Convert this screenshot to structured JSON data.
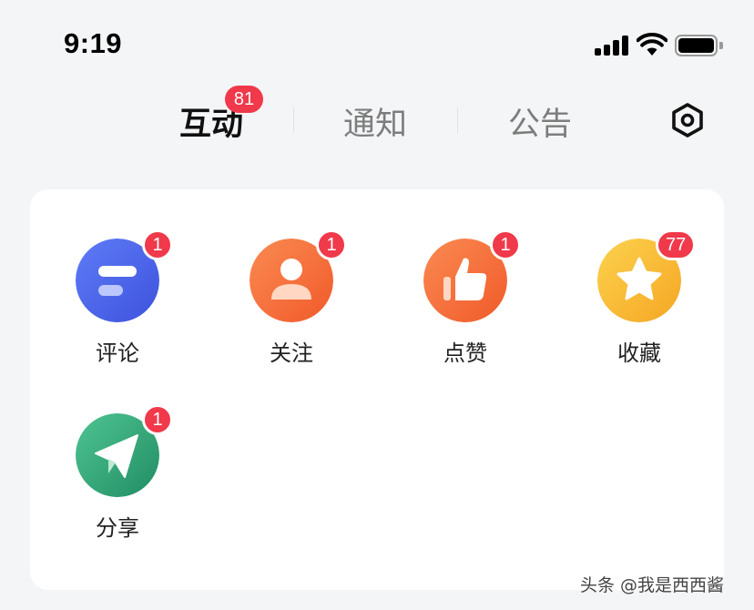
{
  "status_bar": {
    "time": "9:19",
    "icons": [
      "signal-icon",
      "wifi-icon",
      "battery-icon"
    ]
  },
  "tabs": [
    {
      "label": "互动",
      "badge": "81",
      "active": true
    },
    {
      "label": "通知",
      "active": false
    },
    {
      "label": "公告",
      "active": false
    }
  ],
  "header": {
    "settings_icon": "settings-icon"
  },
  "items": [
    {
      "label": "评论",
      "badge": "1",
      "icon": "comment-icon"
    },
    {
      "label": "关注",
      "badge": "1",
      "icon": "follow-icon"
    },
    {
      "label": "点赞",
      "badge": "1",
      "icon": "like-icon"
    },
    {
      "label": "收藏",
      "badge": "77",
      "icon": "favorite-icon"
    },
    {
      "label": "分享",
      "badge": "1",
      "icon": "share-icon"
    }
  ],
  "colors": {
    "badge": "#f0394a",
    "comment_icon": "#4b64ec",
    "follow_icon": "#f36a35",
    "like_icon": "#f36a35",
    "favorite_icon": "#f7b52a",
    "share_icon": "#2fa476"
  },
  "watermark": "头条 @我是西西酱"
}
